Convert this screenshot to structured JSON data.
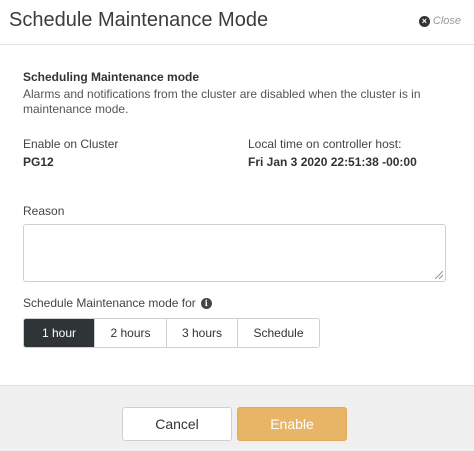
{
  "dialog": {
    "title": "Schedule Maintenance Mode",
    "close_label": "Close"
  },
  "info": {
    "title": "Scheduling Maintenance mode",
    "description": "Alarms and notifications from the cluster are disabled when the cluster is in maintenance mode."
  },
  "cluster": {
    "label": "Enable on Cluster",
    "value": "PG12"
  },
  "local_time": {
    "label": "Local time on controller host:",
    "value": "Fri Jan 3 2020 22:51:38 -00:00"
  },
  "reason": {
    "label": "Reason",
    "value": ""
  },
  "schedule": {
    "label": "Schedule Maintenance mode for",
    "info_icon": "info-icon",
    "options": [
      "1 hour",
      "2 hours",
      "3 hours",
      "Schedule"
    ],
    "selected": "1 hour"
  },
  "footer": {
    "cancel_label": "Cancel",
    "enable_label": "Enable"
  },
  "colors": {
    "accent": "#e8b566",
    "selected_segment": "#2f3437"
  }
}
